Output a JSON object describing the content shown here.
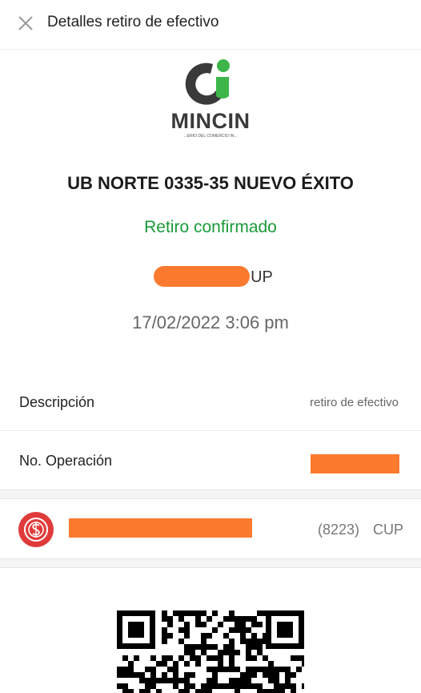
{
  "header": {
    "close_icon": "close-icon",
    "title": "Detalles retiro de efectivo"
  },
  "logo": {
    "name": "MINCIN",
    "subtitle": "...ERIO DEL COMERCIO IN...",
    "colors": {
      "dark": "#3a3a3a",
      "green": "#3db54a"
    }
  },
  "merchant": "UB NORTE 0335-35 NUEVO ÉXITO",
  "status": "Retiro confirmado",
  "amount": {
    "visible_text": "UP",
    "currency_hint": "CUP",
    "redacted": true
  },
  "datetime": "17/02/2022 3:06 pm",
  "details": [
    {
      "label": "Descripción",
      "value": "retiro de efectivo"
    },
    {
      "label": "No. Operación",
      "value": "",
      "redacted": true
    }
  ],
  "card": {
    "icon": "bank-card-icon",
    "number": "(8223)",
    "currency": "CUP",
    "redacted_name": true
  },
  "colors": {
    "status_green": "#1a9a3a",
    "redaction": "#fb7a2e",
    "card_icon_red": "#e03a3a"
  },
  "qr": {
    "icon": "qr-code"
  }
}
